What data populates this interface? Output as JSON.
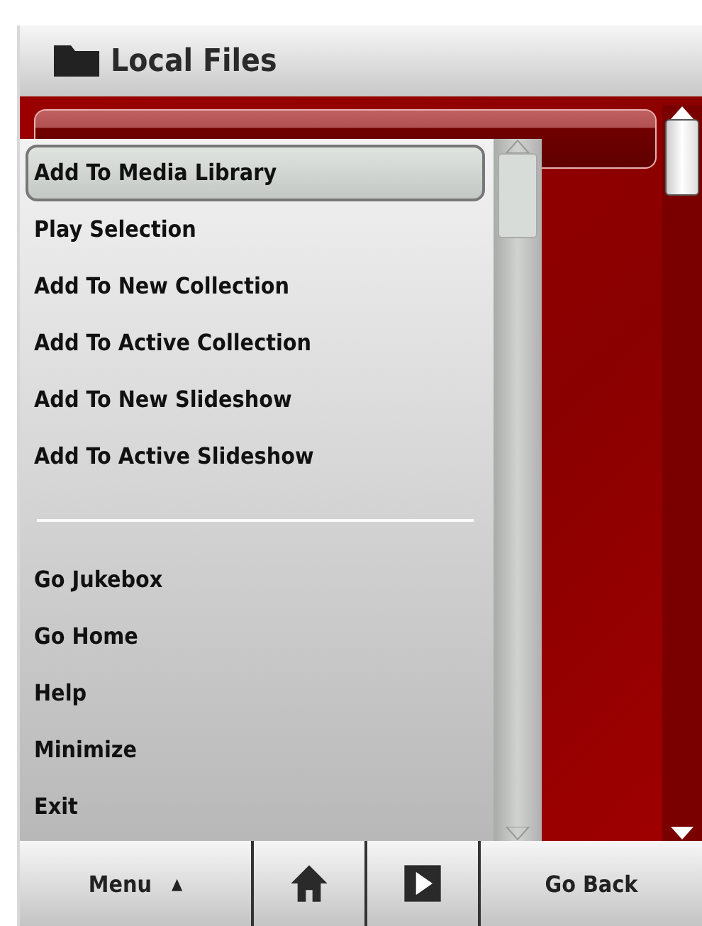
{
  "header": {
    "title": "Local Files"
  },
  "list": {
    "rows": [
      {
        "selected": true
      }
    ]
  },
  "popup_menu": {
    "items": [
      {
        "kind": "item",
        "label": "Add To Media Library",
        "selected": true
      },
      {
        "kind": "item",
        "label": "Play Selection",
        "selected": false
      },
      {
        "kind": "item",
        "label": "Add To New Collection",
        "selected": false
      },
      {
        "kind": "item",
        "label": "Add To Active Collection",
        "selected": false
      },
      {
        "kind": "item",
        "label": "Add To New Slideshow",
        "selected": false
      },
      {
        "kind": "item",
        "label": "Add To Active Slideshow",
        "selected": false
      },
      {
        "kind": "separator"
      },
      {
        "kind": "item",
        "label": "Go Jukebox",
        "selected": false
      },
      {
        "kind": "item",
        "label": "Go Home",
        "selected": false
      },
      {
        "kind": "item",
        "label": "Help",
        "selected": false
      },
      {
        "kind": "item",
        "label": "Minimize",
        "selected": false
      },
      {
        "kind": "item",
        "label": "Exit",
        "selected": false
      }
    ]
  },
  "toolbar": [
    {
      "kind": "menu",
      "label": "Menu",
      "caret": "▲"
    },
    {
      "kind": "home"
    },
    {
      "kind": "play"
    },
    {
      "kind": "text",
      "label": "Go Back"
    }
  ]
}
